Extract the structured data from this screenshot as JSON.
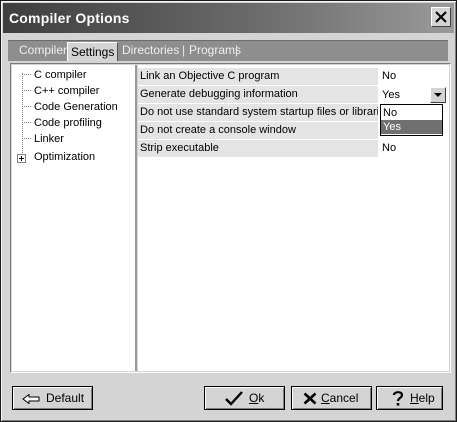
{
  "window": {
    "title": "Compiler Options"
  },
  "tabs": [
    {
      "label": "Compiler",
      "active": false
    },
    {
      "label": "Settings",
      "active": true
    },
    {
      "label": "Directories",
      "active": false
    },
    {
      "label": "Programs",
      "active": false
    }
  ],
  "tab_separator": "|",
  "tree": {
    "items": [
      {
        "label": "C compiler",
        "selected": false
      },
      {
        "label": "C++ compiler",
        "selected": false
      },
      {
        "label": "Code Generation",
        "selected": false
      },
      {
        "label": "Code profiling",
        "selected": false
      },
      {
        "label": "Linker",
        "selected": true
      },
      {
        "label": "Optimization",
        "selected": false,
        "expandable": true
      }
    ]
  },
  "properties": [
    {
      "name": "Link an Objective  C program",
      "value": "No"
    },
    {
      "name": "Generate debugging information",
      "value": "Yes",
      "editing": true
    },
    {
      "name": "Do not use standard system startup files or libraries",
      "value": "No"
    },
    {
      "name": "Do not create a console window",
      "value": "No"
    },
    {
      "name": "Strip executable",
      "value": "No"
    }
  ],
  "dropdown": {
    "options": [
      "No",
      "Yes"
    ],
    "selected": "Yes"
  },
  "buttons": {
    "default": {
      "label": "Default",
      "icon": "arrow-left-icon"
    },
    "ok": {
      "accel": "O",
      "rest": "k",
      "icon": "checkmark-icon"
    },
    "cancel": {
      "accel": "C",
      "rest": "ancel",
      "icon": "x-icon"
    },
    "help": {
      "accel": "H",
      "rest": "elp",
      "icon": "question-mark-icon"
    }
  }
}
